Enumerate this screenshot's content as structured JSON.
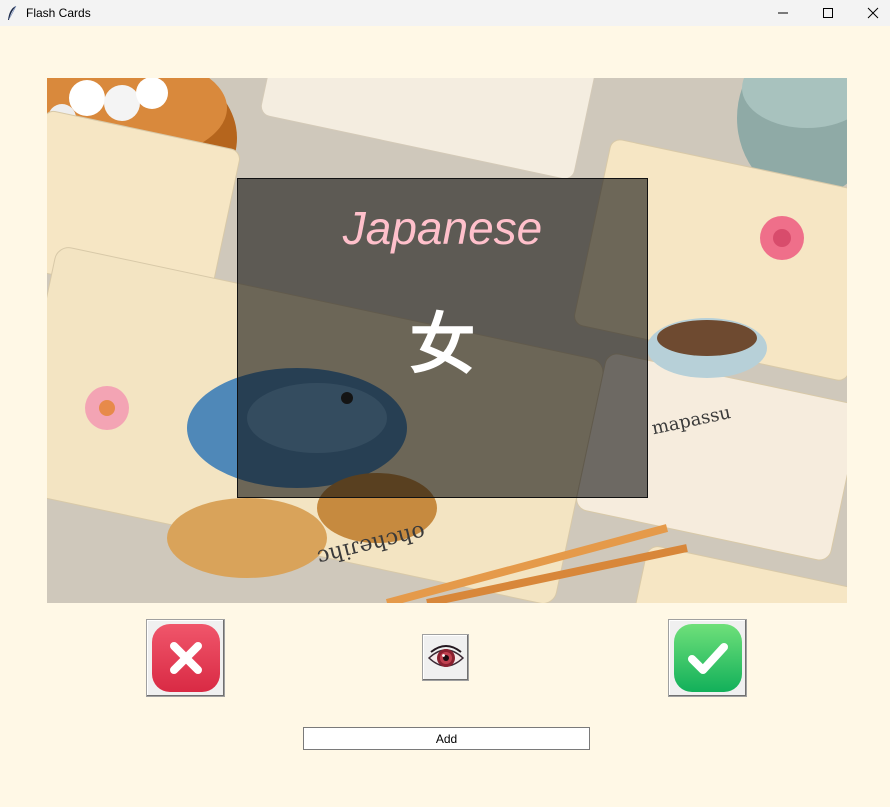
{
  "window": {
    "title": "Flash Cards",
    "icon": "feather-icon",
    "controls": [
      "minimize-icon",
      "maximize-icon",
      "close-icon"
    ]
  },
  "card": {
    "language": "Japanese",
    "word": "女",
    "background_image": "illustrated-japanese-flashcards-photo",
    "colors": {
      "title": "#ffc0cb",
      "word": "#ffffff",
      "overlay": "#0a0a0a"
    }
  },
  "buttons": {
    "wrong": {
      "icon": "red-x-icon",
      "color": "#e5374d"
    },
    "flip": {
      "icon": "eye-icon"
    },
    "right": {
      "icon": "green-check-icon",
      "color": "#22c15e"
    },
    "add_label": "Add"
  },
  "colors": {
    "background": "#fff8e6",
    "titlebar": "#f3f3f3"
  }
}
